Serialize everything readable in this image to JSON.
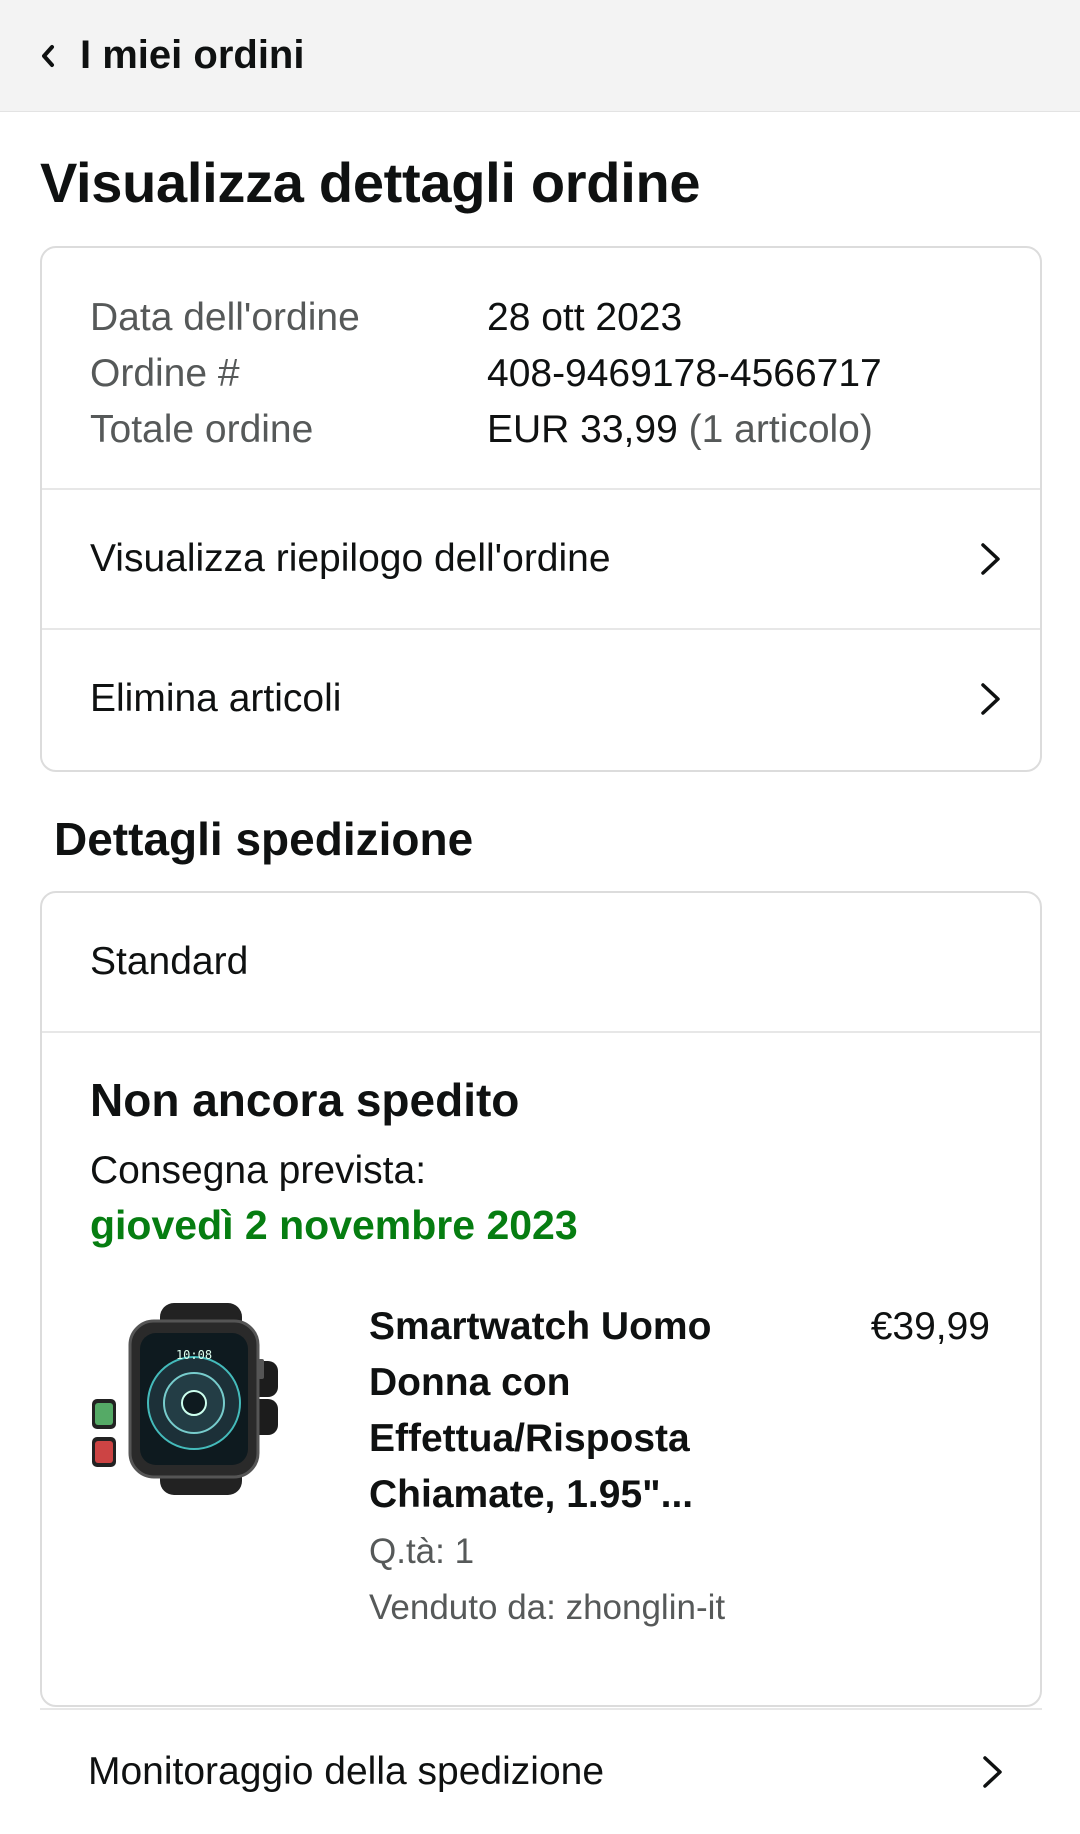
{
  "header": {
    "back_label": "I miei ordini"
  },
  "page_title": "Visualizza dettagli ordine",
  "order": {
    "rows": [
      {
        "label": "Data dell'ordine",
        "value": "28 ott 2023"
      },
      {
        "label": "Ordine #",
        "value": "408-9469178-4566717"
      },
      {
        "label": "Totale ordine",
        "value": "EUR 33,99",
        "suffix": "(1 articolo)"
      }
    ],
    "links": {
      "summary": "Visualizza riepilogo dell'ordine",
      "delete": "Elimina articoli"
    }
  },
  "shipping": {
    "section_title": "Dettagli spedizione",
    "type": "Standard",
    "status": "Non ancora spedito",
    "delivery_label": "Consegna prevista:",
    "delivery_date": "giovedì 2 novembre 2023",
    "item": {
      "title": "Smartwatch Uomo Donna con Effettua/Risposta Chiamate, 1.95\"...",
      "price": "€39,99",
      "qty": "Q.tà: 1",
      "seller": "Venduto da: zhonglin-it",
      "watch_time": "10:08"
    },
    "tracking_label": "Monitoraggio della spedizione"
  },
  "colors": {
    "delivery_green": "#067d11",
    "muted": "#565959"
  }
}
